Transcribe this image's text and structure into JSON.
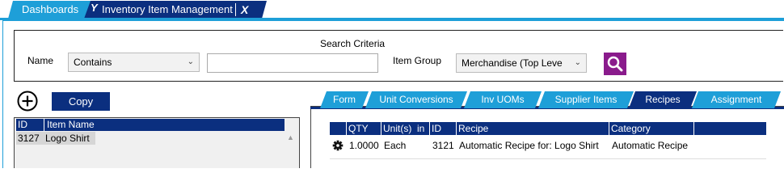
{
  "top_tabs": {
    "dashboards": "Dashboards",
    "inventory": "Inventory Item Management",
    "close": "X",
    "y_mark": "Y"
  },
  "search": {
    "title": "Search Criteria",
    "name_label": "Name",
    "name_operator": "Contains",
    "name_value": "",
    "item_group_label": "Item Group",
    "item_group_value": "Merchandise (Top Leve"
  },
  "left_panel": {
    "copy_label": "Copy",
    "columns": [
      "ID",
      "Item Name"
    ],
    "rows": [
      {
        "id": "3127",
        "name": "Logo Shirt"
      }
    ]
  },
  "right_tabs": [
    {
      "label": "Form",
      "active": false
    },
    {
      "label": "Unit Conversions",
      "active": false
    },
    {
      "label": "Inv UOMs",
      "active": false
    },
    {
      "label": "Supplier Items",
      "active": false
    },
    {
      "label": "Recipes",
      "active": true
    },
    {
      "label": "Assignment",
      "active": false
    }
  ],
  "recipes_grid": {
    "columns": [
      "QTY",
      "Unit(s)",
      "in",
      "ID",
      "Recipe",
      "Category"
    ],
    "rows": [
      {
        "qty": "1.0000",
        "unit": "Each",
        "id": "3121",
        "recipe": "Automatic Recipe for: Logo Shirt",
        "category": "Automatic Recipe"
      }
    ]
  },
  "colors": {
    "accent_light": "#1e9fd8",
    "accent_dark": "#0b2f7f",
    "search_button": "#8a1b8c"
  }
}
